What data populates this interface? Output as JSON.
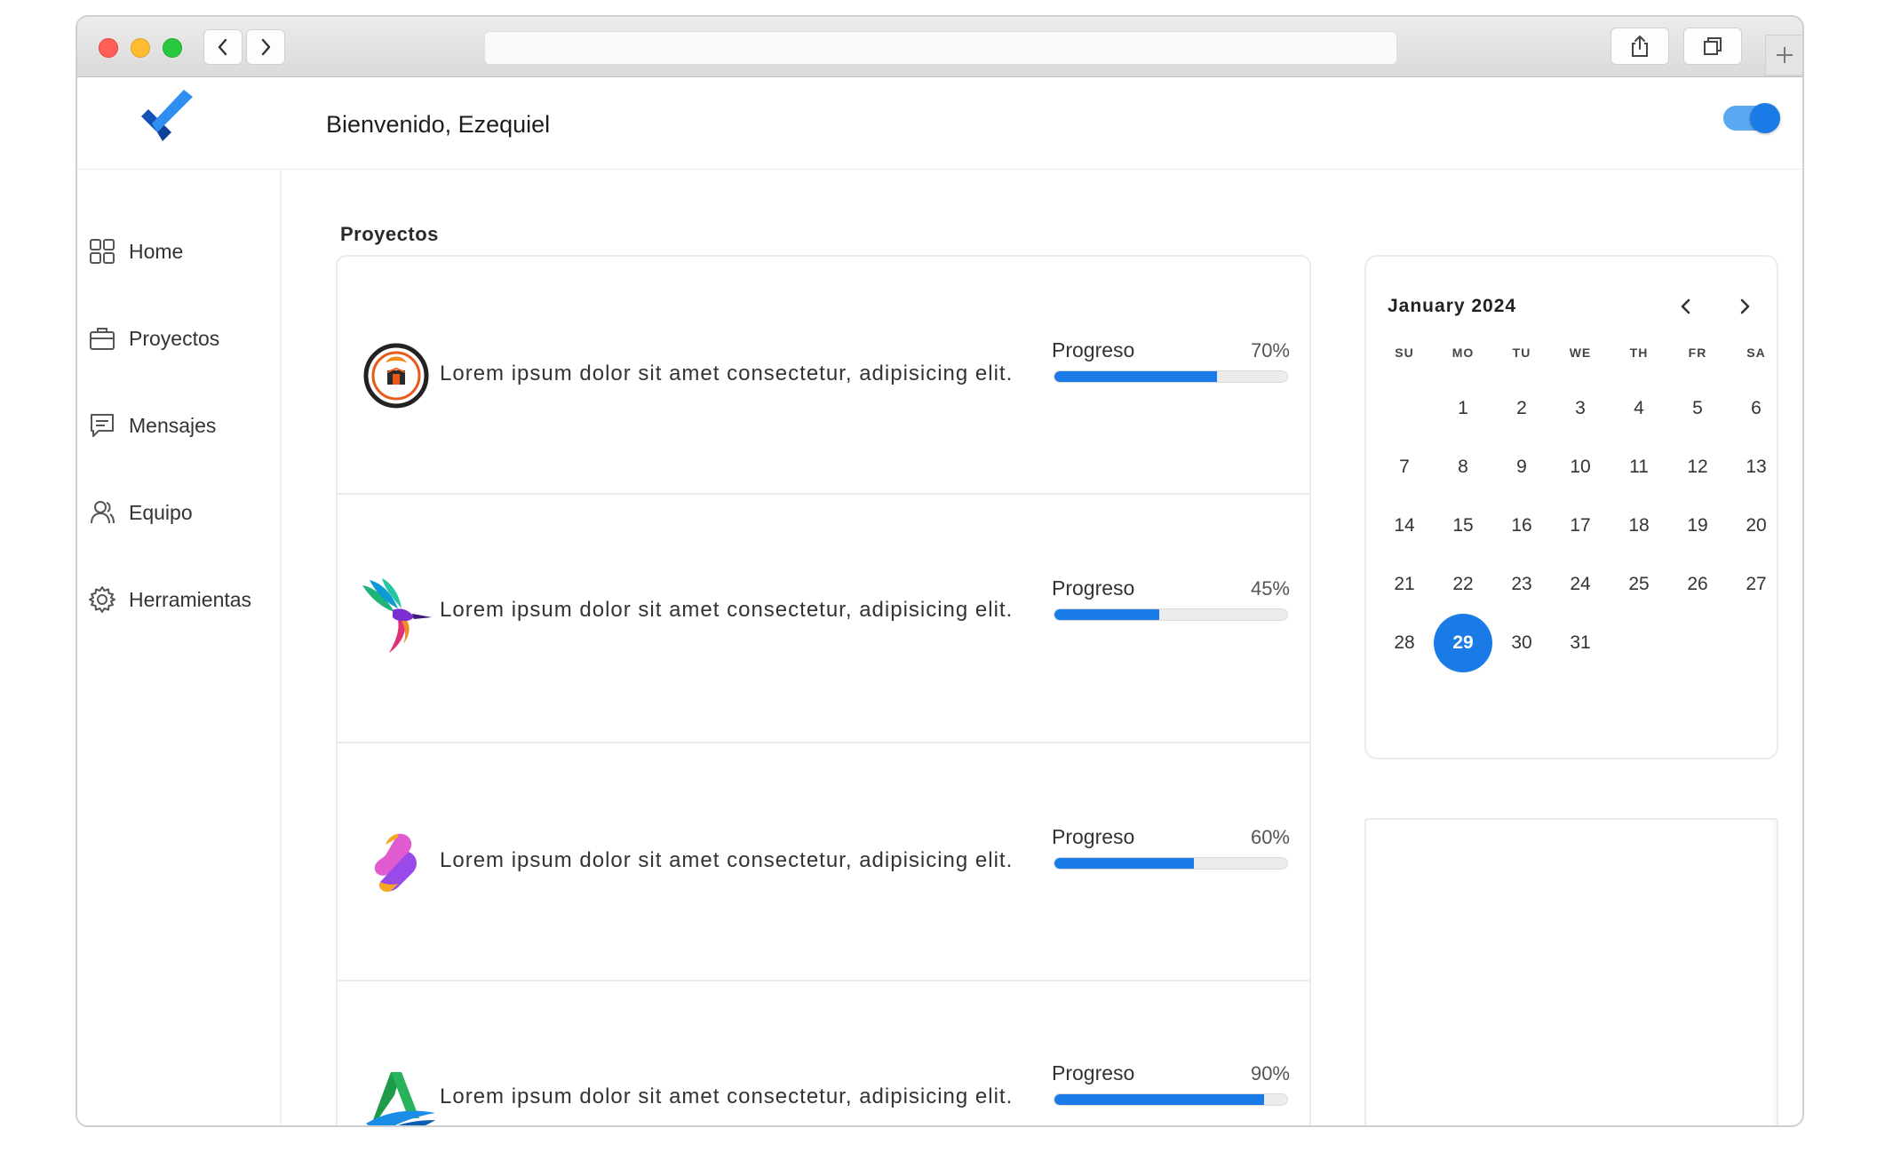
{
  "header": {
    "welcome": "Bienvenido, Ezequiel",
    "toggle_on": true
  },
  "colors": {
    "accent": "#1a7be6",
    "track": "#ececec"
  },
  "sidebar": {
    "items": [
      {
        "label": "Home",
        "icon": "grid-icon"
      },
      {
        "label": "Proyectos",
        "icon": "briefcase-icon"
      },
      {
        "label": "Mensajes",
        "icon": "message-icon"
      },
      {
        "label": "Equipo",
        "icon": "team-icon"
      },
      {
        "label": "Herramientas",
        "icon": "gear-icon"
      }
    ]
  },
  "projects": {
    "title": "Proyectos",
    "items": [
      {
        "logo": "emblem-logo",
        "description": "Lorem ipsum dolor sit amet consectetur, adipisicing elit.",
        "progress_label": "Progreso",
        "progress_text": "70%",
        "progress": 70
      },
      {
        "logo": "hummingbird-logo",
        "description": "Lorem ipsum dolor sit amet consectetur, adipisicing elit.",
        "progress_label": "Progreso",
        "progress_text": "45%",
        "progress": 45
      },
      {
        "logo": "ribbon-logo",
        "description": "Lorem ipsum dolor sit amet consectetur, adipisicing elit.",
        "progress_label": "Progreso",
        "progress_text": "60%",
        "progress": 60
      },
      {
        "logo": "letter-a-logo",
        "description": "Lorem ipsum dolor sit amet consectetur, adipisicing elit.",
        "progress_label": "Progreso",
        "progress_text": "90%",
        "progress": 90
      }
    ]
  },
  "calendar": {
    "month_label": "January 2024",
    "weekdays": [
      "SU",
      "MO",
      "TU",
      "WE",
      "TH",
      "FR",
      "SA"
    ],
    "first_weekday_index": 1,
    "days_in_month": 31,
    "selected_day": 29
  }
}
